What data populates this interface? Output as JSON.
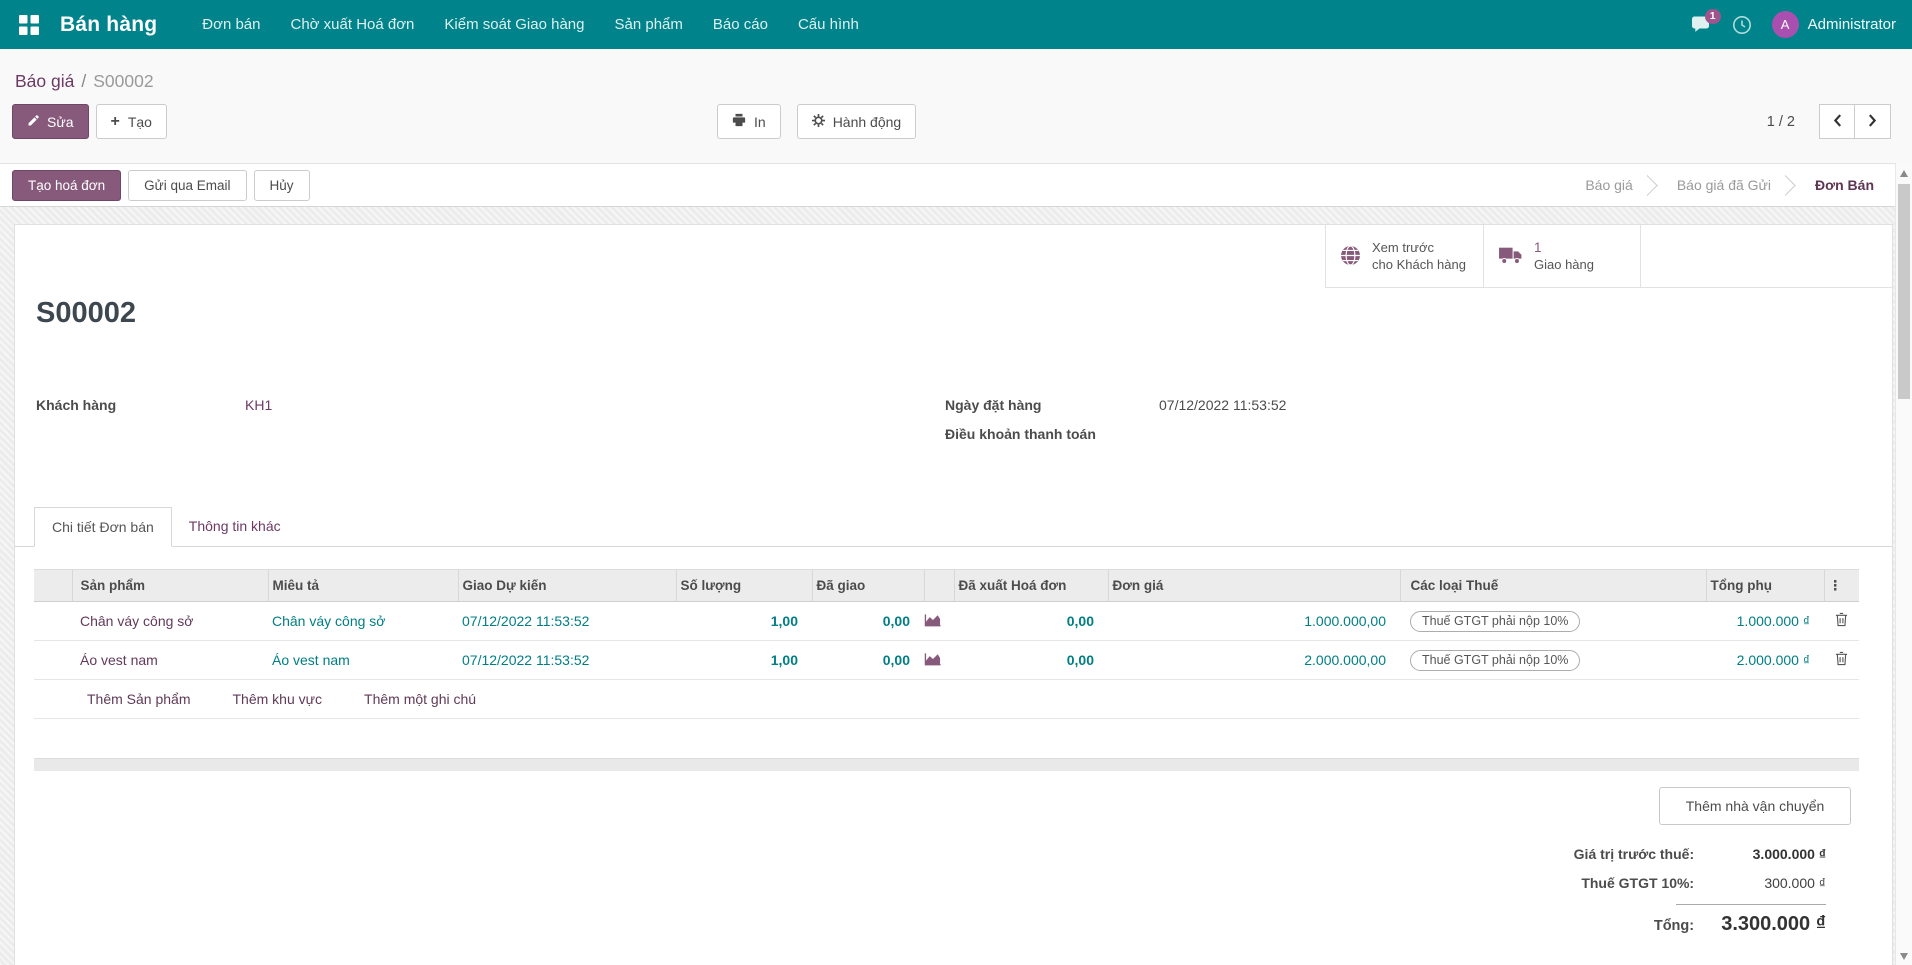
{
  "navbar": {
    "brand": "Bán hàng",
    "menu": [
      "Đơn bán",
      "Chờ xuất Hoá đơn",
      "Kiểm soát Giao hàng",
      "Sản phẩm",
      "Báo cáo",
      "Cấu hình"
    ],
    "messages_badge": "1",
    "user_initial": "A",
    "user_name": "Administrator"
  },
  "breadcrumb": {
    "parent": "Báo giá",
    "separator": "/",
    "current": "S00002"
  },
  "actions": {
    "edit": "Sửa",
    "create": "Tạo",
    "print": "In",
    "action": "Hành động",
    "pager": "1 / 2"
  },
  "statusbar": {
    "create_invoice": "Tạo hoá đơn",
    "send_email": "Gửi qua Email",
    "cancel": "Hủy",
    "steps": [
      "Báo giá",
      "Báo giá đã Gửi",
      "Đơn Bán"
    ]
  },
  "smart_buttons": {
    "preview_line1": "Xem trước",
    "preview_line2": "cho Khách hàng",
    "delivery_count": "1",
    "delivery_label": "Giao hàng"
  },
  "record": {
    "title": "S00002",
    "customer_label": "Khách hàng",
    "customer": "KH1",
    "order_date_label": "Ngày đặt hàng",
    "order_date": "07/12/2022 11:53:52",
    "payment_terms_label": "Điều khoản thanh toán",
    "payment_terms": ""
  },
  "tabs": {
    "details": "Chi tiết Đơn bán",
    "other": "Thông tin khác"
  },
  "order_lines": {
    "headers": {
      "product": "Sản phẩm",
      "description": "Miêu tả",
      "expected_delivery": "Giao Dự kiến",
      "quantity": "Số lượng",
      "delivered": "Đã giao",
      "invoiced": "Đã xuất Hoá đơn",
      "unit_price": "Đơn giá",
      "taxes": "Các loại Thuế",
      "subtotal": "Tổng phụ",
      "more": "⋮"
    },
    "rows": [
      {
        "product": "Chân váy công sở",
        "description": "Chân váy công sở",
        "expected_delivery": "07/12/2022 11:53:52",
        "quantity": "1,00",
        "delivered": "0,00",
        "invoiced": "0,00",
        "unit_price": "1.000.000,00",
        "taxes": "Thuế GTGT phải nộp 10%",
        "subtotal": "1.000.000 ₫"
      },
      {
        "product": "Áo vest nam",
        "description": "Áo vest nam",
        "expected_delivery": "07/12/2022 11:53:52",
        "quantity": "1,00",
        "delivered": "0,00",
        "invoiced": "0,00",
        "unit_price": "2.000.000,00",
        "taxes": "Thuế GTGT phải nộp 10%",
        "subtotal": "2.000.000 ₫"
      }
    ],
    "add_product": "Thêm Sản phẩm",
    "add_section": "Thêm khu vực",
    "add_note": "Thêm một ghi chú"
  },
  "totals": {
    "add_shipping": "Thêm nhà vận chuyển",
    "untaxed_label": "Giá trị trước thuế:",
    "untaxed_value": "3.000.000 ₫",
    "tax_label": "Thuế GTGT 10%:",
    "tax_value": "300.000 ₫",
    "total_label": "Tổng:",
    "total_value": "3.300.000 ₫"
  },
  "colors": {
    "navbar_teal": "#00838a",
    "primary_purple": "#875A7B",
    "teal_text": "#017e84",
    "link_purple": "#6d3a64"
  }
}
